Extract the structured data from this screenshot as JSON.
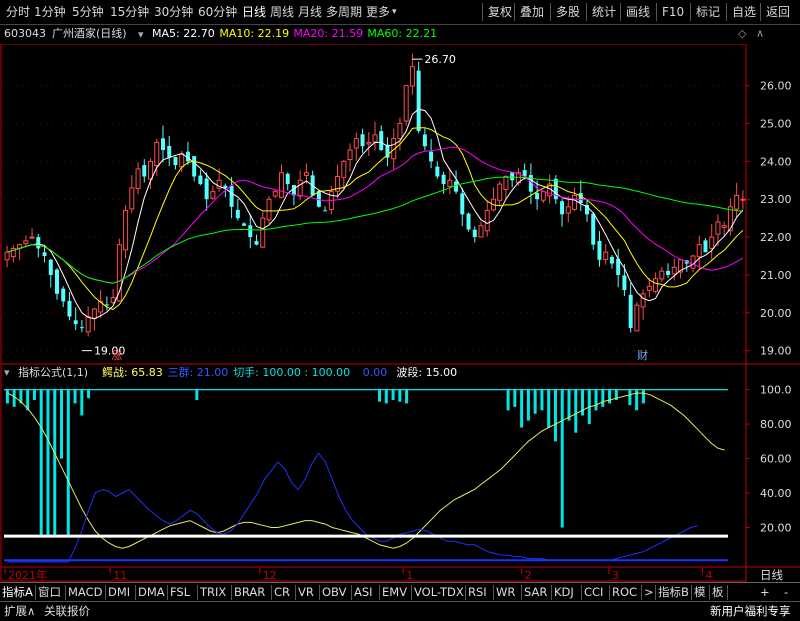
{
  "toolbar": {
    "periods": [
      "分时",
      "1分钟",
      "5分钟",
      "15分钟",
      "30分钟",
      "60分钟",
      "日线",
      "周线",
      "月线",
      "多周期",
      "更多"
    ],
    "active_period": "日线",
    "actions": [
      "复权",
      "叠加",
      "多股",
      "统计",
      "画线",
      "F10",
      "标记",
      "自选",
      "返回"
    ]
  },
  "stock": {
    "code": "603043",
    "name": "广州酒家(日线)"
  },
  "ma_legend": [
    {
      "label": "MA5:",
      "value": "22.70",
      "color": "#ffffff"
    },
    {
      "label": "MA10:",
      "value": "22.19",
      "color": "#ffff00"
    },
    {
      "label": "MA20:",
      "value": "21.59",
      "color": "#ff00ff"
    },
    {
      "label": "MA60:",
      "value": "22.21",
      "color": "#00ff00"
    }
  ],
  "indicator_legend": {
    "name": "指标公式(1,1)",
    "items": [
      {
        "label": "鳄战:",
        "value": "65.83",
        "color": "#ffff66"
      },
      {
        "label": "三群:",
        "value": "21.00",
        "color": "#3355ff"
      },
      {
        "label": "切手:",
        "value": "100.00 : 100.00",
        "color": "#00e5e5"
      },
      {
        "label": "",
        "value": "0.00",
        "color": "#3355ff"
      },
      {
        "label": "波段:",
        "value": "15.00",
        "color": "#ffffff"
      }
    ]
  },
  "colors": {
    "up": "#ff4c4c",
    "down": "#54ffff",
    "ma5": "#ffffff",
    "ma10": "#ffff00",
    "ma20": "#ff00ff",
    "ma60": "#00ff00",
    "axis": "#c00000",
    "blue": "#2030ff"
  },
  "main_axis": {
    "ticks": [
      "26.00",
      "25.00",
      "24.00",
      "23.00",
      "22.00",
      "21.00",
      "20.00",
      "19.00"
    ]
  },
  "indicator_axis": {
    "ticks": [
      "100.0",
      "80.00",
      "60.00",
      "40.00",
      "20.00"
    ]
  },
  "annotations": {
    "high": "26.70",
    "low": "19.00",
    "buy_mark": "涨",
    "fin_mark": "财"
  },
  "x_axis": {
    "labels": [
      "2021年",
      "11",
      "12",
      "1",
      "2",
      "3",
      "4"
    ],
    "right_label": "日线"
  },
  "tabs": [
    "指标A",
    "窗口",
    "MACD",
    "DMI",
    "DMA",
    "FSL",
    "TRIX",
    "BRAR",
    "CR",
    "VR",
    "OBV",
    "ASI",
    "EMV",
    "VOL-TDX",
    "RSI",
    "WR",
    "SAR",
    "KDJ",
    "CCI",
    "ROC",
    ">",
    "指标B",
    "模",
    "板"
  ],
  "bottom": {
    "expand": "扩展∧",
    "related": "关联报价",
    "promo": "新用户福利专享",
    "plus": "+",
    "dash": "-"
  },
  "chart_data": {
    "type": "candlestick",
    "ylim": [
      18.7,
      27.1
    ],
    "x_tick_labels": [
      "2021年",
      "11",
      "12",
      "1",
      "2",
      "3",
      "4"
    ],
    "series": [
      {
        "name": "MA5",
        "value": 22.7
      },
      {
        "name": "MA10",
        "value": 22.19
      },
      {
        "name": "MA20",
        "value": 21.59
      },
      {
        "name": "MA60",
        "value": 22.21
      }
    ],
    "close": [
      21.6,
      21.7,
      21.8,
      21.9,
      22.0,
      21.7,
      21.5,
      21.0,
      20.5,
      20.3,
      19.9,
      19.7,
      19.6,
      19.9,
      20.1,
      20.3,
      20.2,
      20.4,
      21.8,
      22.7,
      23.3,
      23.8,
      23.6,
      24.0,
      24.5,
      24.3,
      24.1,
      23.9,
      24.2,
      24.0,
      23.6,
      23.4,
      23.0,
      23.2,
      23.5,
      23.3,
      22.8,
      22.5,
      22.3,
      22.0,
      21.8,
      22.5,
      23.0,
      23.2,
      23.7,
      23.4,
      23.1,
      23.5,
      23.7,
      23.1,
      22.8,
      22.7,
      23.2,
      23.6,
      24.0,
      24.3,
      24.6,
      24.4,
      24.5,
      24.7,
      24.3,
      24.1,
      24.6,
      25.0,
      26.0,
      26.5,
      24.8,
      24.4,
      24.0,
      23.6,
      23.4,
      23.5,
      23.2,
      22.6,
      22.2,
      22.0,
      22.3,
      22.7,
      23.0,
      23.4,
      23.6,
      23.5,
      23.7,
      23.6,
      23.2,
      23.0,
      23.2,
      23.4,
      23.0,
      22.6,
      22.8,
      23.1,
      22.9,
      22.6,
      21.8,
      21.4,
      21.6,
      21.3,
      21.0,
      20.6,
      19.6,
      20.2,
      20.5,
      20.7,
      20.9,
      21.1,
      21.0,
      21.2,
      21.4,
      21.3,
      21.5,
      21.8,
      21.6,
      22.0,
      22.4,
      22.3,
      22.8,
      23.1,
      23.0
    ],
    "indicator": {
      "ylim": [
        0,
        105
      ],
      "ticks": [
        100,
        80,
        60,
        40,
        20
      ],
      "yellow": [
        98,
        96,
        93,
        89,
        84,
        78,
        71,
        63,
        55,
        47,
        39,
        31,
        24,
        18,
        14,
        11,
        9,
        8,
        9,
        11,
        13,
        15,
        17,
        19,
        21,
        22,
        23,
        24,
        22,
        20,
        18,
        17,
        18,
        20,
        22,
        23,
        23,
        22,
        21,
        20,
        20,
        21,
        22,
        23,
        24,
        24,
        23,
        22,
        20,
        19,
        18,
        17,
        16,
        14,
        12,
        10,
        9,
        8,
        9,
        11,
        14,
        18,
        22,
        26,
        30,
        33,
        36,
        38,
        40,
        42,
        45,
        48,
        51,
        54,
        58,
        62,
        66,
        70,
        73,
        76,
        78,
        80,
        82,
        84,
        86,
        88,
        90,
        91,
        93,
        94,
        95,
        96,
        97,
        98,
        98,
        97,
        95,
        93,
        91,
        88,
        85,
        81,
        77,
        73,
        69,
        66,
        65
      ],
      "blue": [
        0,
        0,
        0,
        0,
        0,
        0,
        0,
        0,
        0,
        0,
        8,
        18,
        30,
        40,
        42,
        41,
        38,
        40,
        42,
        38,
        34,
        30,
        27,
        24,
        22,
        24,
        27,
        30,
        28,
        24,
        20,
        17,
        16,
        18,
        22,
        28,
        34,
        40,
        48,
        53,
        58,
        54,
        46,
        42,
        48,
        57,
        63,
        58,
        48,
        38,
        30,
        24,
        20,
        16,
        14,
        12,
        12,
        14,
        16,
        17,
        18,
        19,
        18,
        16,
        14,
        12,
        12,
        11,
        10,
        10,
        8,
        6,
        5,
        4,
        4,
        3,
        3,
        2,
        2,
        2,
        1,
        1,
        1,
        1,
        1,
        1,
        1,
        1,
        1,
        1,
        2,
        3,
        4,
        5,
        6,
        8,
        10,
        12,
        14,
        16,
        18,
        20,
        21
      ],
      "band": 15,
      "bars": [
        {
          "i": 0,
          "top": 100,
          "bottom": 92
        },
        {
          "i": 1,
          "top": 100,
          "bottom": 90
        },
        {
          "i": 2,
          "top": 100,
          "bottom": 92
        },
        {
          "i": 3,
          "top": 100,
          "bottom": 88
        },
        {
          "i": 4,
          "top": 100,
          "bottom": 94
        },
        {
          "i": 5,
          "top": 100,
          "bottom": 15
        },
        {
          "i": 6,
          "top": 100,
          "bottom": 15
        },
        {
          "i": 7,
          "top": 100,
          "bottom": 15
        },
        {
          "i": 8,
          "top": 100,
          "bottom": 60
        },
        {
          "i": 9,
          "top": 100,
          "bottom": 15
        },
        {
          "i": 10,
          "top": 100,
          "bottom": 92
        },
        {
          "i": 11,
          "top": 100,
          "bottom": 85
        },
        {
          "i": 12,
          "top": 100,
          "bottom": 95
        },
        {
          "i": 28,
          "top": 100,
          "bottom": 94
        },
        {
          "i": 55,
          "top": 100,
          "bottom": 93
        },
        {
          "i": 56,
          "top": 100,
          "bottom": 92
        },
        {
          "i": 57,
          "top": 100,
          "bottom": 94
        },
        {
          "i": 58,
          "top": 100,
          "bottom": 93
        },
        {
          "i": 59,
          "top": 100,
          "bottom": 92
        },
        {
          "i": 74,
          "top": 100,
          "bottom": 88
        },
        {
          "i": 75,
          "top": 100,
          "bottom": 90
        },
        {
          "i": 76,
          "top": 100,
          "bottom": 78
        },
        {
          "i": 77,
          "top": 100,
          "bottom": 82
        },
        {
          "i": 78,
          "top": 100,
          "bottom": 86
        },
        {
          "i": 79,
          "top": 100,
          "bottom": 88
        },
        {
          "i": 80,
          "top": 100,
          "bottom": 78
        },
        {
          "i": 81,
          "top": 100,
          "bottom": 70
        },
        {
          "i": 82,
          "top": 100,
          "bottom": 20
        },
        {
          "i": 83,
          "top": 100,
          "bottom": 82
        },
        {
          "i": 84,
          "top": 100,
          "bottom": 75
        },
        {
          "i": 85,
          "top": 100,
          "bottom": 85
        },
        {
          "i": 86,
          "top": 100,
          "bottom": 80
        },
        {
          "i": 87,
          "top": 100,
          "bottom": 88
        },
        {
          "i": 88,
          "top": 100,
          "bottom": 90
        },
        {
          "i": 89,
          "top": 100,
          "bottom": 92
        },
        {
          "i": 90,
          "top": 100,
          "bottom": 94
        },
        {
          "i": 92,
          "top": 100,
          "bottom": 91
        },
        {
          "i": 93,
          "top": 100,
          "bottom": 88
        },
        {
          "i": 94,
          "top": 100,
          "bottom": 92
        }
      ]
    }
  }
}
